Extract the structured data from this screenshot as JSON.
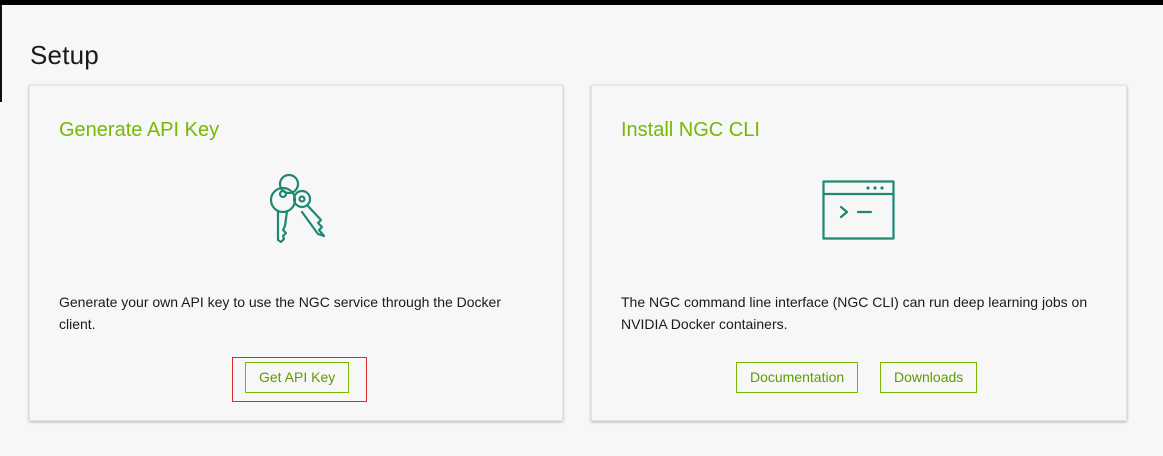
{
  "page": {
    "title": "Setup"
  },
  "cards": {
    "api_key": {
      "title": "Generate API Key",
      "icon": "keys-icon",
      "description": "Generate your own API key to use the NGC service through the Docker client.",
      "button_label": "Get API Key"
    },
    "cli": {
      "title": "Install NGC CLI",
      "icon": "terminal-icon",
      "description": "The NGC command line interface (NGC CLI) can run deep learning jobs on NVIDIA Docker containers.",
      "documentation_label": "Documentation",
      "downloads_label": "Downloads"
    }
  },
  "colors": {
    "accent": "#76b900",
    "icon": "#1e8873",
    "highlight": "#e0262c"
  }
}
